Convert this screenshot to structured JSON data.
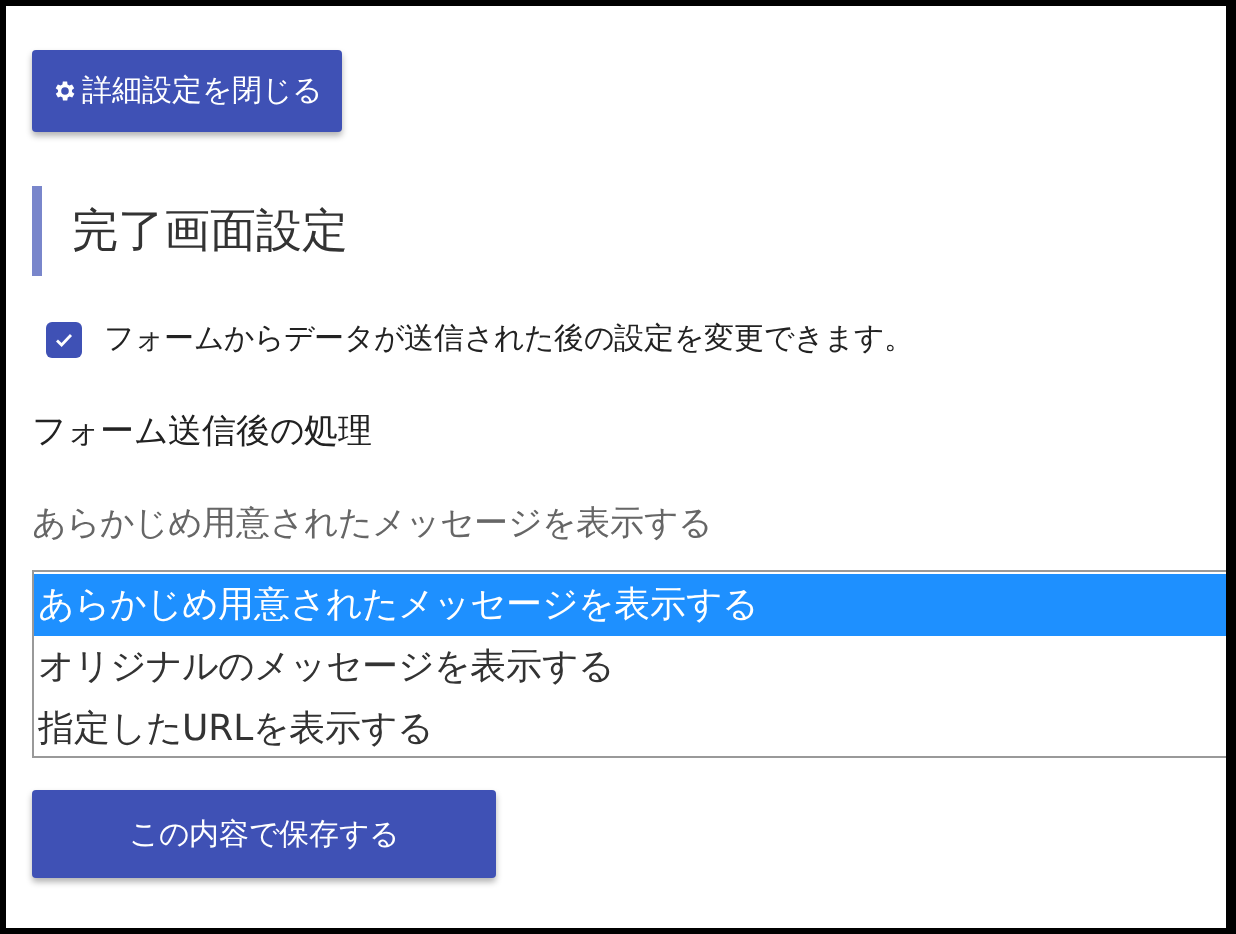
{
  "close_button": {
    "label": "詳細設定を閉じる"
  },
  "heading": "完了画面設定",
  "enable_checkbox": {
    "label": "フォームからデータが送信された後の設定を変更できます。",
    "checked": true
  },
  "section_label": "フォーム送信後の処理",
  "current_value": "あらかじめ用意されたメッセージを表示する",
  "options": [
    {
      "label": "あらかじめ用意されたメッセージを表示する",
      "selected": true
    },
    {
      "label": "オリジナルのメッセージを表示する",
      "selected": false
    },
    {
      "label": "指定したURLを表示する",
      "selected": false
    }
  ],
  "save_button": {
    "label": "この内容で保存する"
  }
}
